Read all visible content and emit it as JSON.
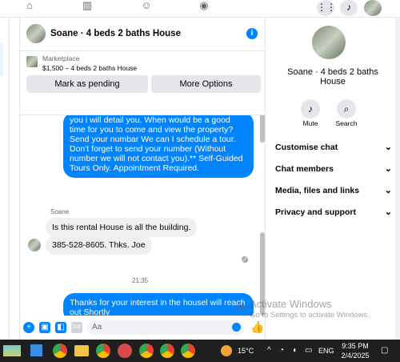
{
  "topnav": {
    "notif_icon": "bell-icon",
    "menu_icon": "grid-icon"
  },
  "chat": {
    "title": "Soane · 4 beds 2 baths House",
    "listing": {
      "source": "Marketplace",
      "price_title": "$1,500 – 4 beds 2 baths House",
      "pending_label": "Mark as pending",
      "more_label": "More Options"
    },
    "messages": {
      "outgoing_1": "you i will detail you.  When would be a good time for you to come and view the property? Send your numbar We can I schedule a tour.  Don't forget to send your number (Without number we will not contact you).** Self-Guided Tours Only. Appointment Required.",
      "sender_name": "Soane",
      "incoming_1": "Is this rental House is all the building.",
      "incoming_2": "385-528-8605.  Thks. Joe",
      "timestamp": "21:35",
      "outgoing_2": "Thanks for your interest in the housel will reach out Shortly",
      "status": "Sent"
    },
    "composer": {
      "placeholder": "Aa"
    }
  },
  "info": {
    "title": "Soane · 4 beds 2 baths House",
    "mute_label": "Mute",
    "search_label": "Search",
    "sections": [
      "Customise chat",
      "Chat members",
      "Media, files and links",
      "Privacy and support"
    ]
  },
  "watermark": {
    "line1": "Activate Windows",
    "line2": "Go to Settings to activate Windows."
  },
  "taskbar": {
    "temperature": "15°C",
    "language": "ENG",
    "time": "9:35 PM",
    "date": "2/4/2025"
  },
  "colors": {
    "accent": "#0084ff",
    "taskbar": "#1f1f1f"
  }
}
